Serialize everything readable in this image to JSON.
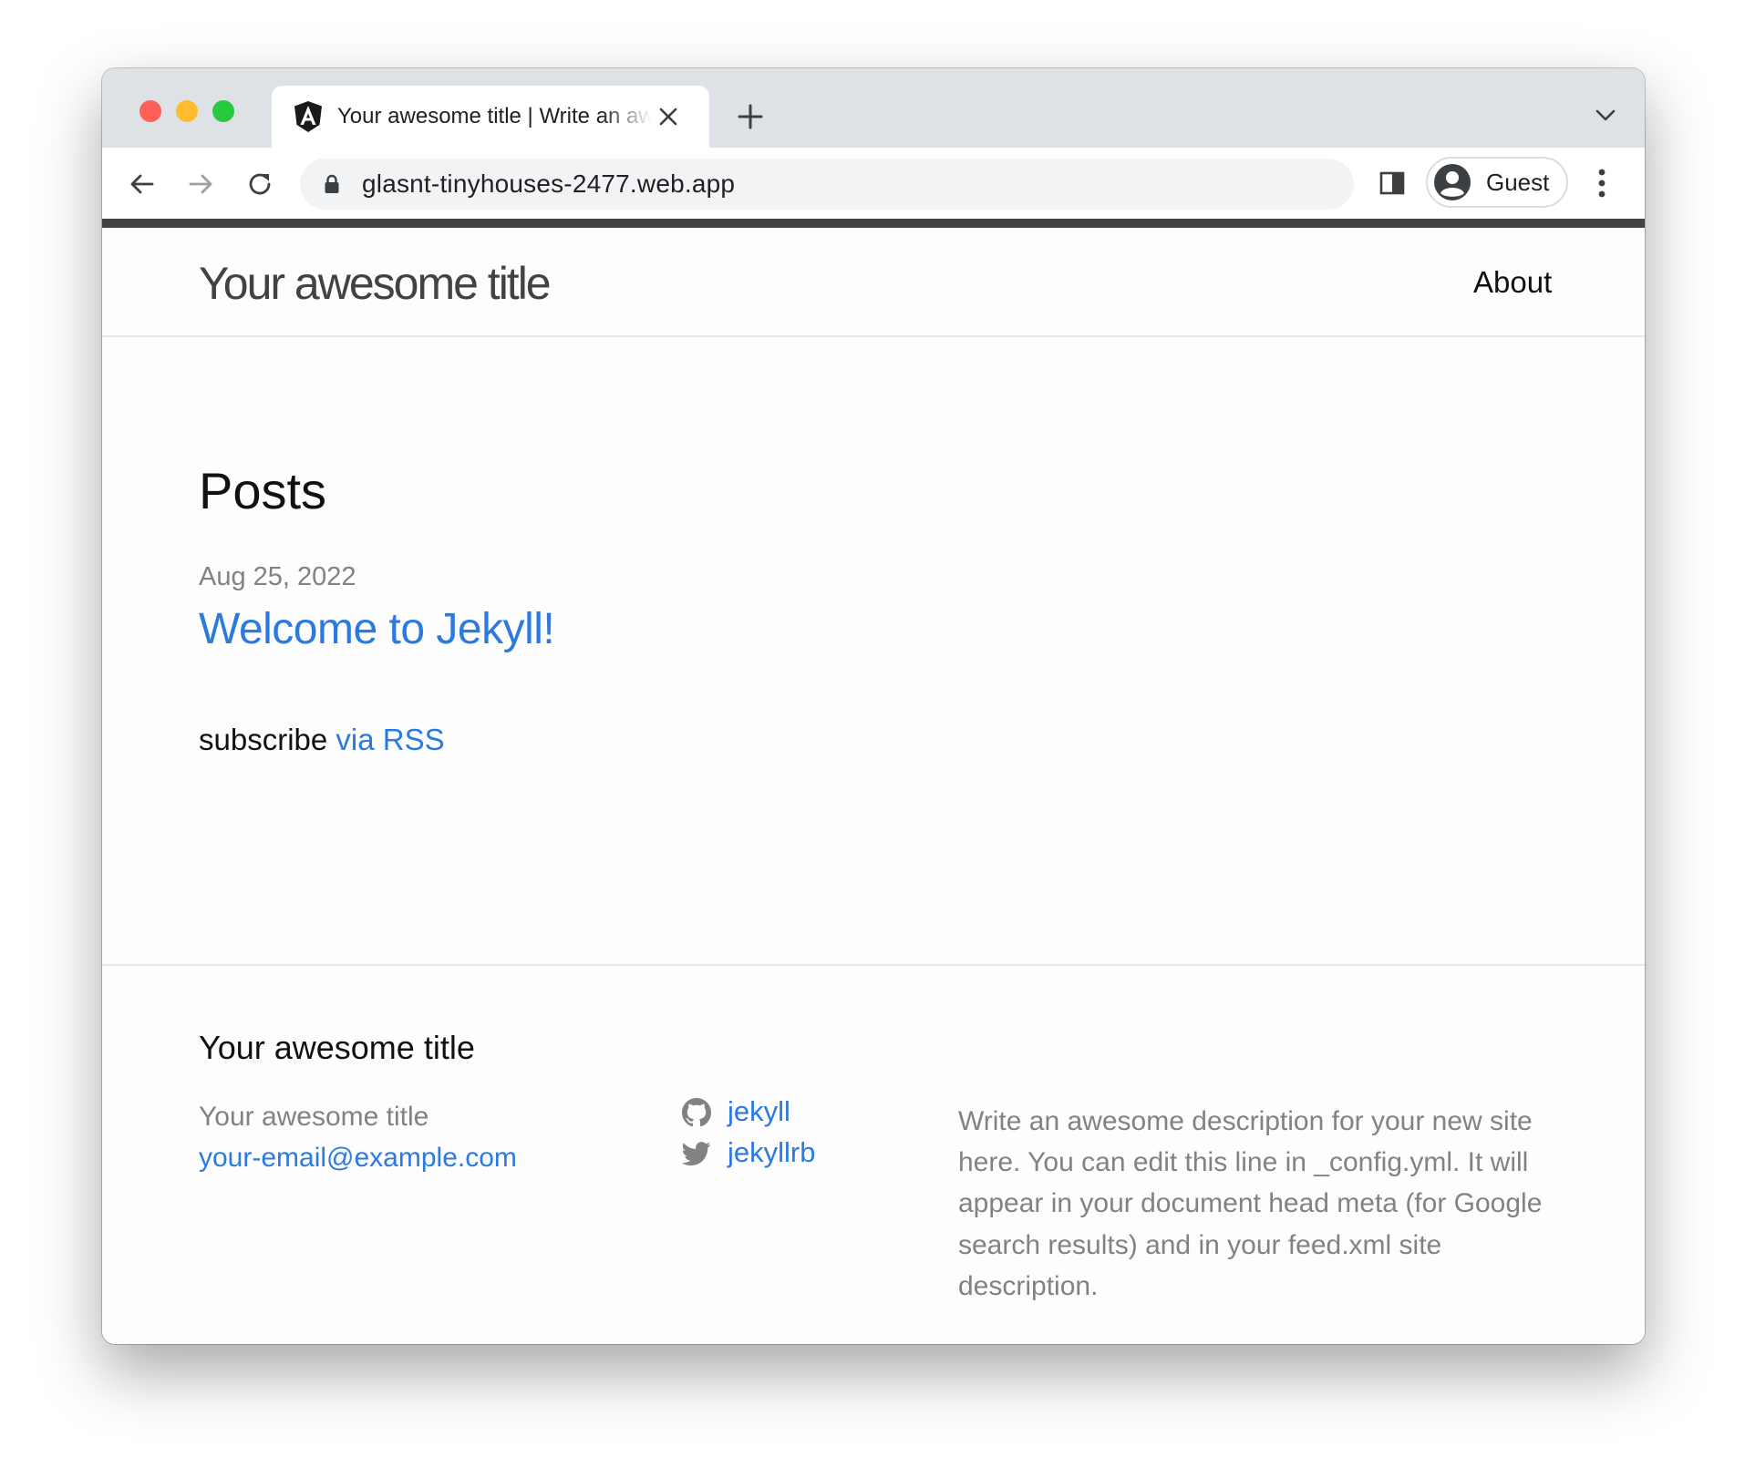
{
  "browser": {
    "tab": {
      "title": "Your awesome title | Write an awesome description for your new site here."
    },
    "omnibox": {
      "url": "glasnt-tinyhouses-2477.web.app"
    },
    "profile": {
      "label": "Guest"
    }
  },
  "header": {
    "site_title": "Your awesome title",
    "nav": [
      {
        "label": "About"
      }
    ]
  },
  "main": {
    "heading": "Posts",
    "posts": [
      {
        "date": "Aug 25, 2022",
        "title": "Welcome to Jekyll!"
      }
    ],
    "subscribe": {
      "text": "subscribe",
      "link_label": "via RSS"
    }
  },
  "footer": {
    "heading": "Your awesome title",
    "name": "Your awesome title",
    "email": "your-email@example.com",
    "social": [
      {
        "icon": "github-icon",
        "label": "jekyll"
      },
      {
        "icon": "twitter-icon",
        "label": "jekyllrb"
      }
    ],
    "description": "Write an awesome description for your new site here. You can edit this line in _config.yml. It will appear in your document head meta (for Google search results) and in your feed.xml site description."
  },
  "colors": {
    "link": "#2a7ae2",
    "text": "#111111",
    "muted": "#828282",
    "topbar": "#424242"
  }
}
